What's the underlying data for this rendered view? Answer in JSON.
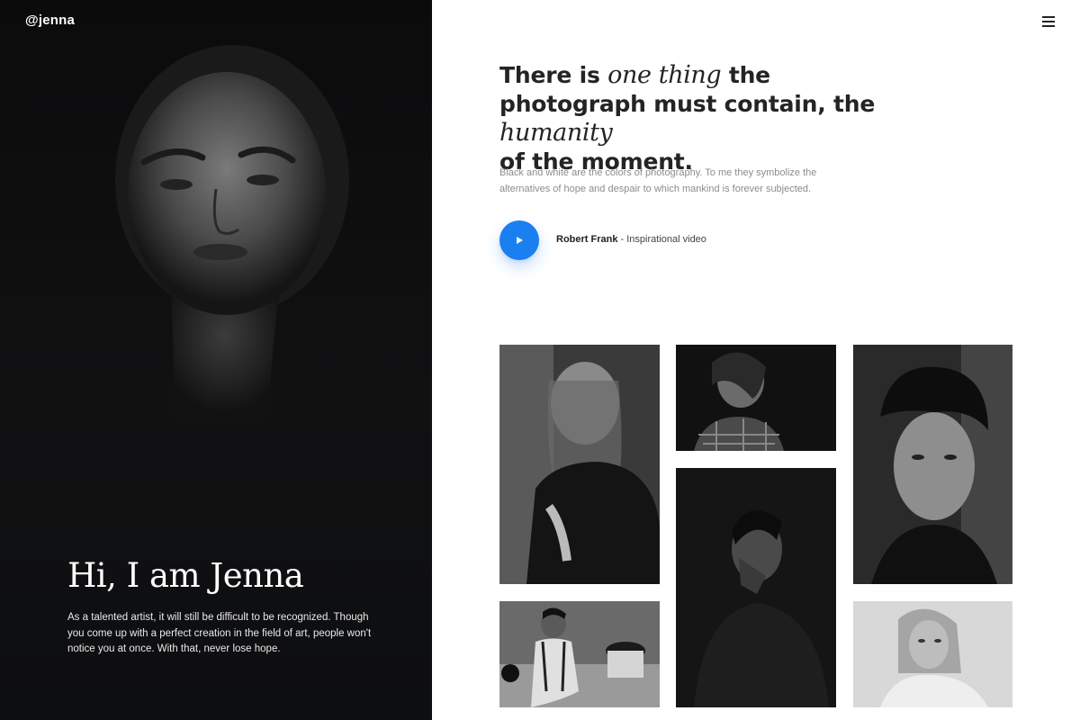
{
  "header": {
    "brand": "@jenna",
    "menu_icon": "hamburger-menu-icon"
  },
  "hero": {
    "title": "Hi, I am Jenna",
    "text": "As a talented artist, it will still be difficult to be recognized. Though you come up with a perfect creation in the field of art, people won't notice you at once. With that, never lose hope."
  },
  "quote": {
    "part1": "There is ",
    "em1": "one thing",
    "part2": " the photograph must contain, the ",
    "em2": "humanity",
    "part3": "of the moment."
  },
  "description": "Black and white are the colors of photography. To me they symbolize the alternatives of hope and despair to which mankind is forever subjected.",
  "video": {
    "author": "Robert Frank",
    "separator": " - ",
    "label": "Inspirational video",
    "play_icon": "play-icon",
    "accent_color": "#1a7ff0"
  },
  "gallery": {
    "photos": [
      "woman-long-hair-photo",
      "woman-plaid-shirt-photo",
      "young-man-curly-hair-photo",
      "man-suspenders-sitting-photo",
      "man-profile-dark-photo",
      "woman-blonde-photo"
    ]
  }
}
